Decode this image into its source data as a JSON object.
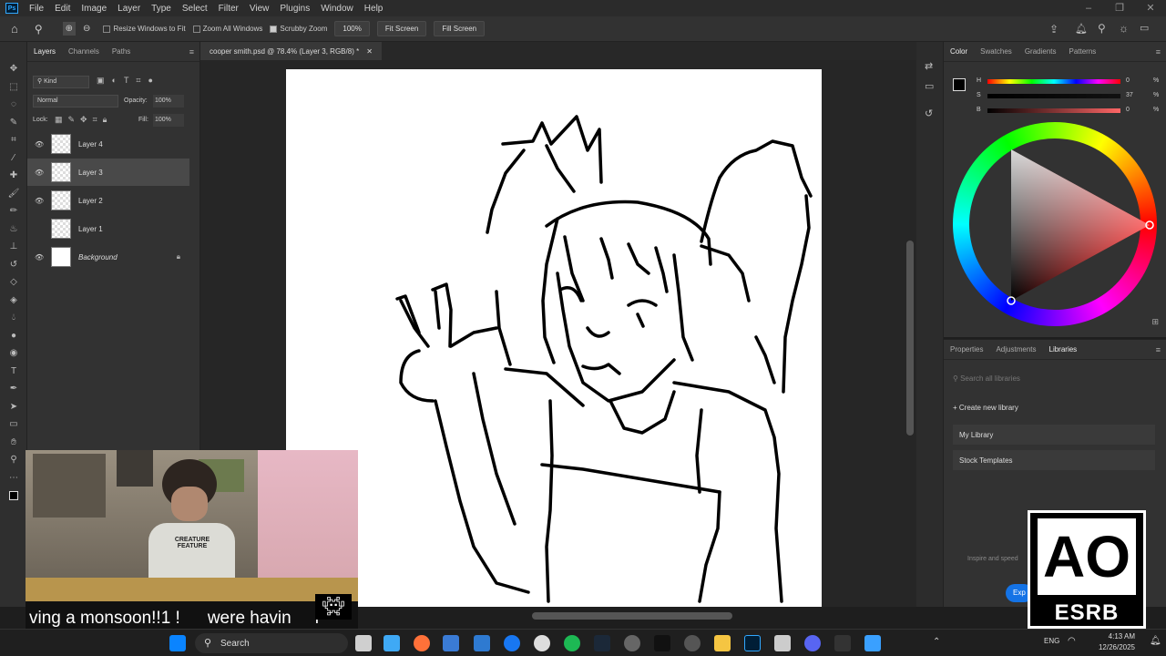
{
  "menubar": {
    "app_icon": "Ps",
    "items": [
      "File",
      "Edit",
      "Image",
      "Layer",
      "Type",
      "Select",
      "Filter",
      "View",
      "Plugins",
      "Window",
      "Help"
    ]
  },
  "options_bar": {
    "resize_windows": "Resize Windows to Fit",
    "zoom_all": "Zoom All Windows",
    "scrubby_zoom": "Scrubby Zoom",
    "zoom_value": "100%",
    "fit_screen": "Fit Screen",
    "fill_screen": "Fill Screen"
  },
  "layers_panel": {
    "tabs": [
      "Layers",
      "Channels",
      "Paths"
    ],
    "filter_kind": "Kind",
    "blend_mode": "Normal",
    "opacity_label": "Opacity:",
    "opacity_value": "100%",
    "lock_label": "Lock:",
    "fill_label": "Fill:",
    "fill_value": "100%",
    "layers": [
      {
        "name": "Layer 4",
        "visible": true,
        "selected": false
      },
      {
        "name": "Layer 3",
        "visible": true,
        "selected": true
      },
      {
        "name": "Layer 2",
        "visible": true,
        "selected": false
      },
      {
        "name": "Layer 1",
        "visible": false,
        "selected": false
      },
      {
        "name": "Background",
        "visible": true,
        "selected": false
      }
    ]
  },
  "document": {
    "tab_title": "cooper smith.psd @ 78.4% (Layer 3, RGB/8) *"
  },
  "color_panel": {
    "tabs": [
      "Color",
      "Swatches",
      "Gradients",
      "Patterns"
    ],
    "h_label": "H",
    "h_value": "0",
    "s_label": "S",
    "s_value": "37",
    "b_label": "B",
    "b_value": "0",
    "percent": "%"
  },
  "libraries_panel": {
    "tabs": [
      "Properties",
      "Adjustments",
      "Libraries"
    ],
    "search_placeholder": "Search all libraries",
    "create": "Create new library",
    "items": [
      "My Library",
      "Stock Templates"
    ],
    "hint": "Inspire and speed",
    "explore_btn": "Exp"
  },
  "stream": {
    "caption_a": "ving a monsoon!!1 !",
    "caption_b": "were havin",
    "caption_c": "r",
    "shirt_text": "CREATURE FEATURE"
  },
  "esrb": {
    "rating": "AO",
    "label": "ESRB"
  },
  "taskbar": {
    "search": "Search",
    "lang": "ENG",
    "time": "4:13 AM",
    "date": "12/26/2025"
  },
  "colors": {
    "accent": "#31a8ff",
    "panel": "#323232",
    "canvas_bg": "#262626"
  }
}
